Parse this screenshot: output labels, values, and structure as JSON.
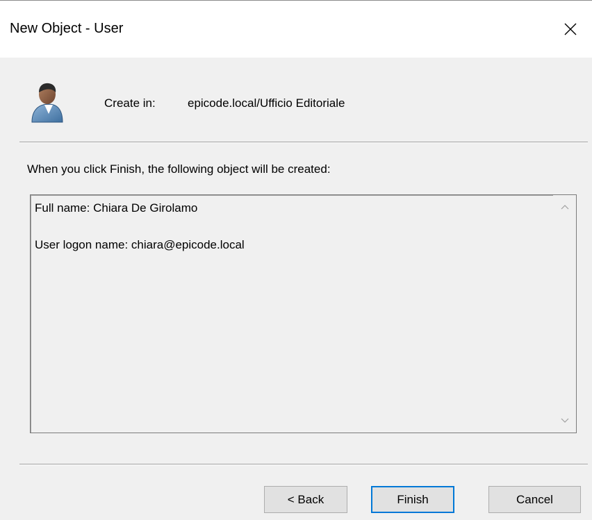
{
  "window": {
    "title": "New Object - User"
  },
  "header": {
    "create_in_label": "Create in:",
    "create_in_path": "epicode.local/Ufficio Editoriale"
  },
  "main": {
    "info_text": "When you click Finish, the following object will be created:",
    "summary_lines": [
      "Full name: Chiara De Girolamo",
      "User logon name: chiara@epicode.local"
    ]
  },
  "buttons": {
    "back_label": "< Back",
    "finish_label": "Finish",
    "cancel_label": "Cancel"
  },
  "icons": {
    "close": "close-icon",
    "user": "user-icon",
    "scroll_up": "chevron-up-icon",
    "scroll_down": "chevron-down-icon"
  },
  "colors": {
    "dialog_background": "#f0f0f0",
    "title_background": "#ffffff",
    "default_button_border": "#0078d7",
    "button_face": "#e1e1e1"
  }
}
